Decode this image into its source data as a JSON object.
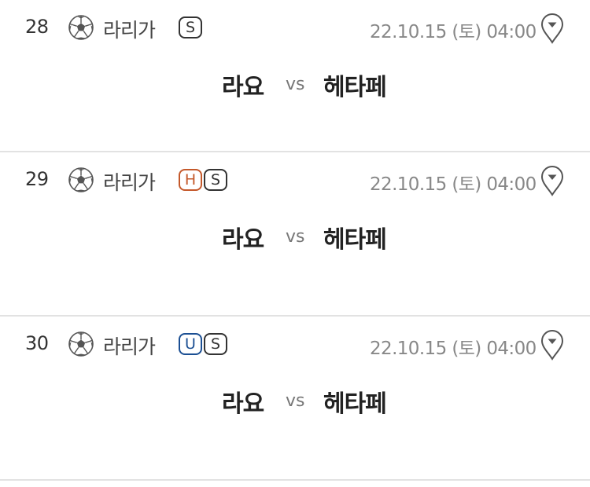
{
  "matches": [
    {
      "number": "28",
      "league": "라리가",
      "badges": [
        {
          "label": "S",
          "kind": "s"
        }
      ],
      "date": "22.10.15 (토) 04:00",
      "home": "라요",
      "vs": "vs",
      "away": "헤타페"
    },
    {
      "number": "29",
      "league": "라리가",
      "badges": [
        {
          "label": "H",
          "kind": "h"
        },
        {
          "label": "S",
          "kind": "s"
        }
      ],
      "date": "22.10.15 (토) 04:00",
      "home": "라요",
      "vs": "vs",
      "away": "헤타페"
    },
    {
      "number": "30",
      "league": "라리가",
      "badges": [
        {
          "label": "U",
          "kind": "u"
        },
        {
          "label": "S",
          "kind": "s"
        }
      ],
      "date": "22.10.15 (토) 04:00",
      "home": "라요",
      "vs": "vs",
      "away": "헤타페"
    }
  ],
  "icons": {
    "sport": "soccer-ball-icon",
    "location": "location-pin-icon"
  },
  "colors": {
    "badge_h": "#c4582a",
    "badge_u": "#1b4f93",
    "badge_s": "#333333",
    "divider": "#e2e2e2"
  }
}
